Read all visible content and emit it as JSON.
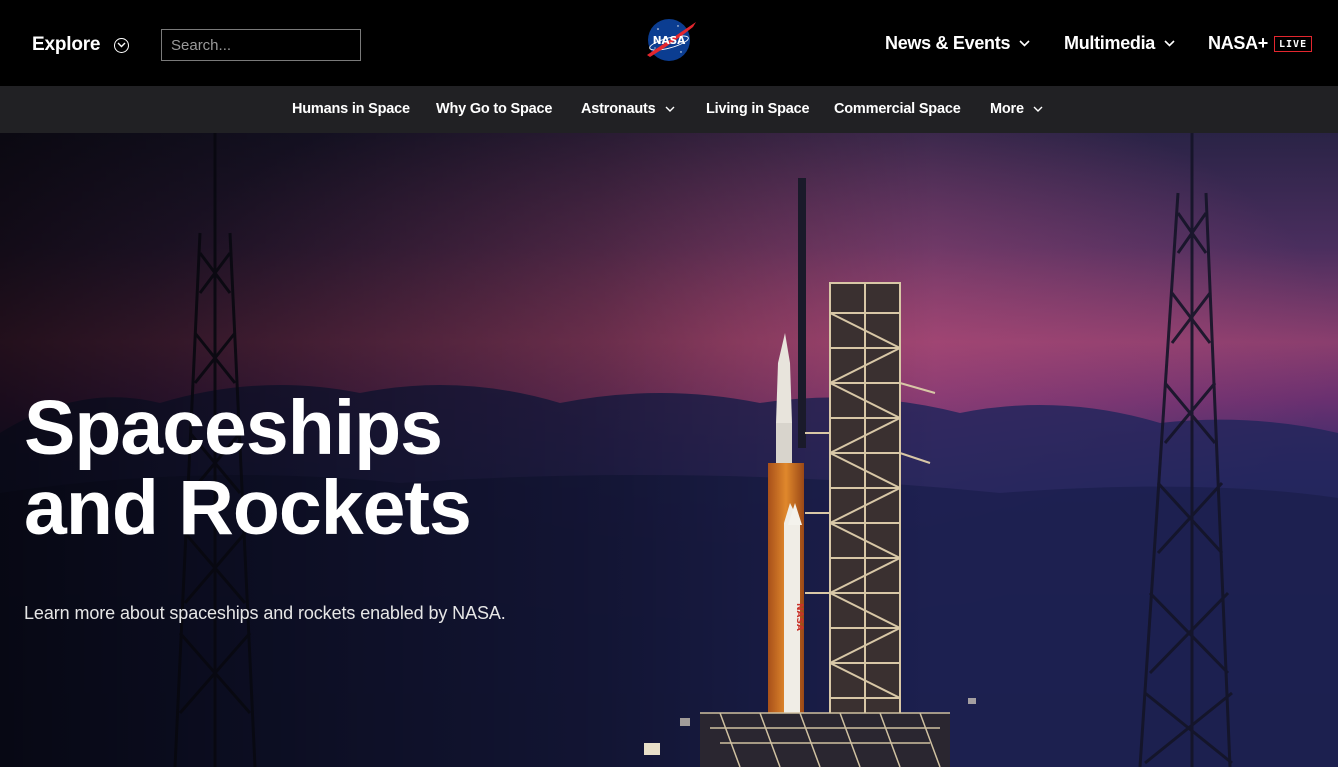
{
  "topbar": {
    "explore_label": "Explore",
    "search_placeholder": "Search...",
    "logo_text": "NASA",
    "nav": [
      {
        "label": "News & Events",
        "has_dropdown": true
      },
      {
        "label": "Multimedia",
        "has_dropdown": true
      },
      {
        "label": "NASA+",
        "badge": "LIVE"
      }
    ]
  },
  "subnav": {
    "items": [
      {
        "label": "Humans in Space"
      },
      {
        "label": "Why Go to Space"
      },
      {
        "label": "Astronauts",
        "has_dropdown": true
      },
      {
        "label": "Living in Space"
      },
      {
        "label": "Commercial Space"
      },
      {
        "label": "More",
        "has_dropdown": true
      }
    ]
  },
  "hero": {
    "title_line1": "Spaceships",
    "title_line2": "and Rockets",
    "subtitle": "Learn more about spaceships and rockets enabled by NASA."
  },
  "colors": {
    "accent_red": "#e4262e",
    "nasa_blue": "#0b3d91",
    "subbar_bg": "#212124"
  },
  "icons": [
    "chevron-down-icon",
    "circle-chevron-icon",
    "nasa-meatball-logo"
  ]
}
